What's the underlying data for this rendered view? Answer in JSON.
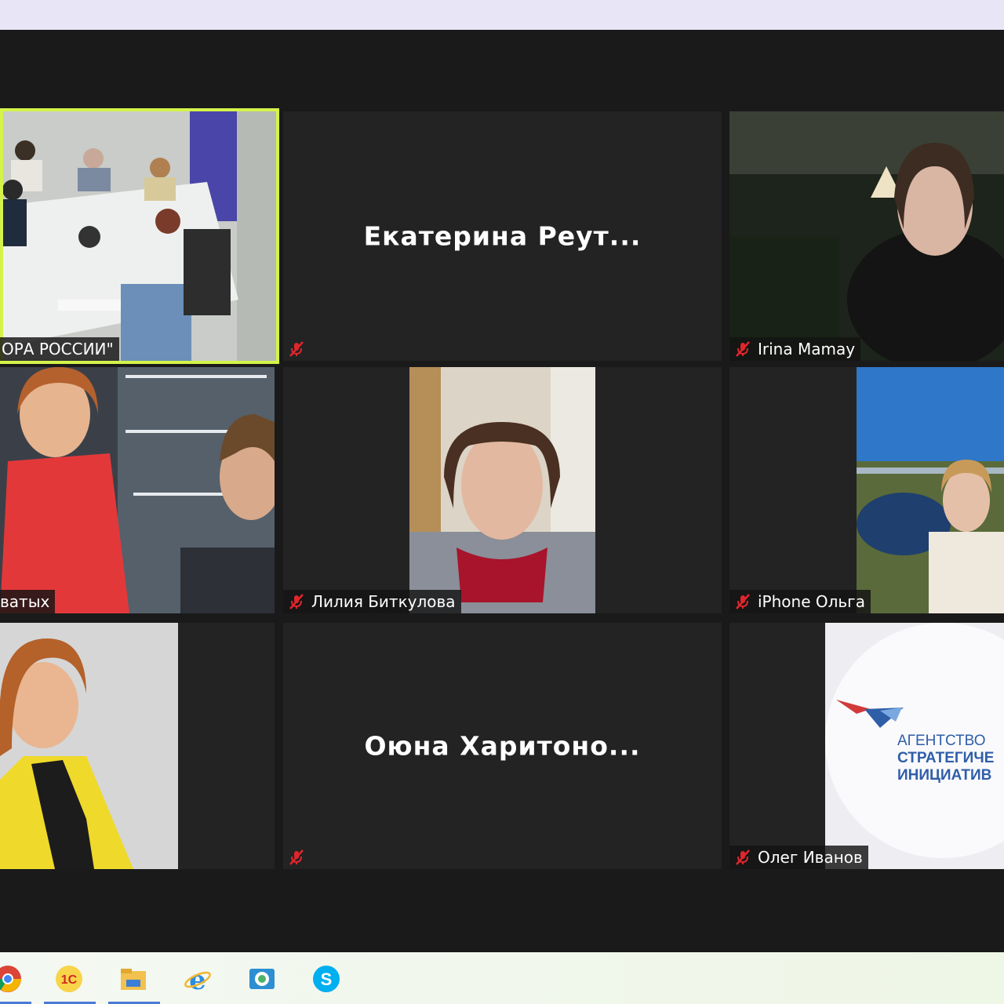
{
  "window": {
    "title": ""
  },
  "participants": [
    {
      "id": "room",
      "name": "ОРА РОССИИ\"",
      "active": true,
      "muted": false,
      "video": true
    },
    {
      "id": "ekaterina",
      "name": "",
      "display_name": "Екатерина  Реут...",
      "muted": true,
      "video": false
    },
    {
      "id": "irina",
      "name": "Irina Mamay",
      "muted": true,
      "video": true
    },
    {
      "id": "speaker-pair",
      "name": "ватых",
      "muted": false,
      "video": true
    },
    {
      "id": "liliya",
      "name": "Лилия Биткулова",
      "muted": true,
      "video": true
    },
    {
      "id": "olga",
      "name": "iPhone Ольга",
      "muted": true,
      "video": true
    },
    {
      "id": "yellow-woman",
      "name": "",
      "muted": false,
      "video": true
    },
    {
      "id": "oyuna",
      "name": "",
      "display_name": "Оюна  Харитоно...",
      "muted": true,
      "video": false
    },
    {
      "id": "oleg",
      "name": "Олег Иванов",
      "muted": true,
      "video": true
    }
  ],
  "virtual_background": {
    "line1": "АГЕНТСТВО",
    "line2": "СТРАТЕГИЧЕ",
    "line3": "ИНИЦИАТИВ"
  },
  "taskbar": {
    "icons": [
      "chrome-icon",
      "1c-icon",
      "file-explorer-icon",
      "internet-explorer-icon",
      "photo-viewer-icon",
      "skype-icon"
    ],
    "onec_label": "1С"
  },
  "colors": {
    "active_border": "#d4f34a",
    "tile_bg": "#232323",
    "stage_bg": "#1a1a1a",
    "mute_red": "#e0262c"
  }
}
